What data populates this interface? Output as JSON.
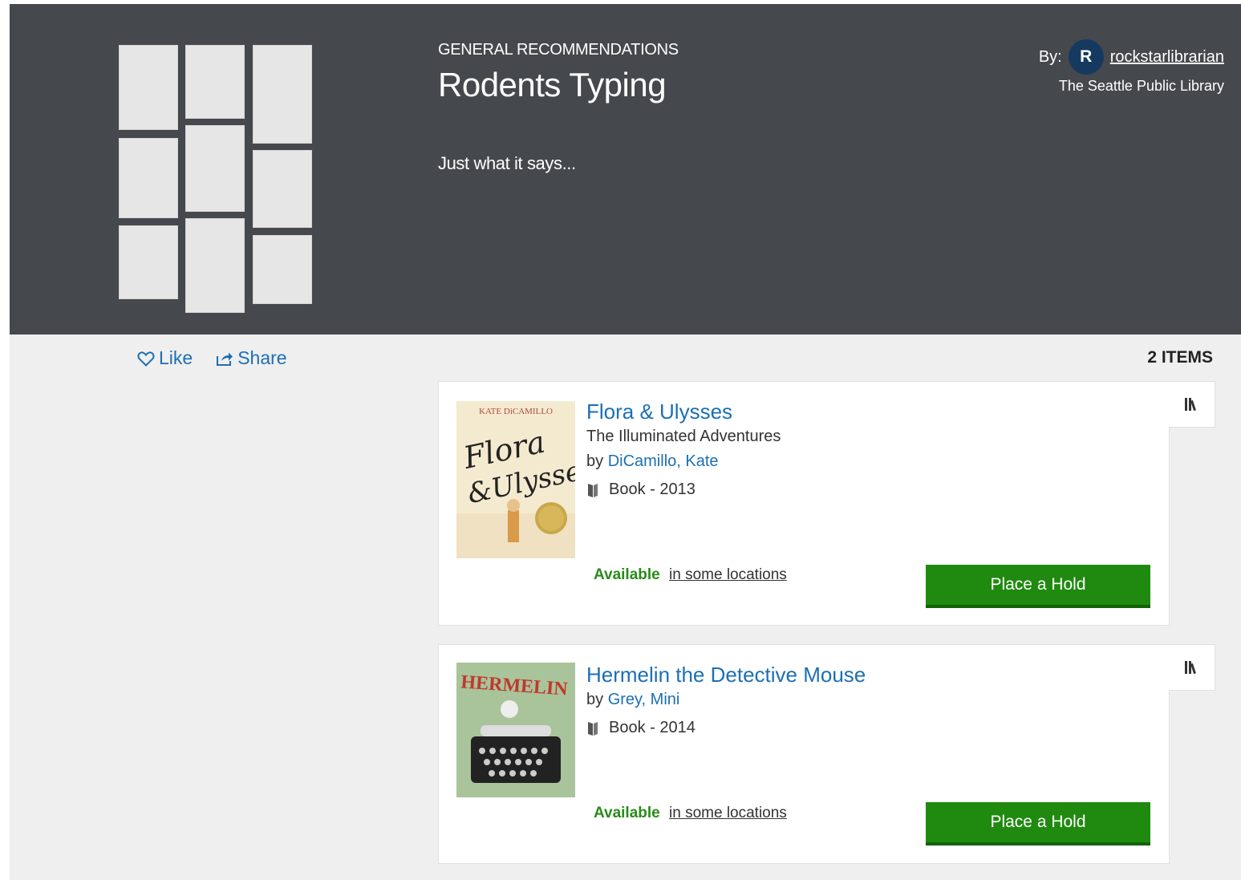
{
  "header": {
    "eyebrow": "GENERAL RECOMMENDATIONS",
    "title": "Rodents Typing",
    "description": "Just what it says...",
    "by_label": "By:",
    "avatar_initial": "R",
    "author": "rockstarlibrarian",
    "library": "The Seattle Public Library"
  },
  "actions": {
    "like": "Like",
    "share": "Share"
  },
  "item_count": "2 ITEMS",
  "items": [
    {
      "title": "Flora & Ulysses",
      "subtitle": "The Illuminated Adventures",
      "by": "by",
      "author": "DiCamillo, Kate",
      "format": "Book - 2013",
      "availability": "Available",
      "availability_link": "in some locations",
      "hold_label": "Place a Hold",
      "cover": {
        "top_text": "KATE DiCAMILLO",
        "script_text_1": "Flora",
        "script_text_2": "&Ulysses"
      }
    },
    {
      "title": "Hermelin the Detective Mouse",
      "by": "by",
      "author": "Grey, Mini",
      "format": "Book - 2014",
      "availability": "Available",
      "availability_link": "in some locations",
      "hold_label": "Place a Hold",
      "cover": {
        "top_text": "HERMELIN"
      }
    }
  ],
  "colors": {
    "header_bg": "#45484d",
    "link": "#1c6fb4",
    "available": "#2a8a1a",
    "hold_button": "#1f8a0f",
    "avatar": "#163a5f"
  },
  "icons": {
    "like": "heart-icon",
    "share": "share-icon",
    "shelf": "shelf-icon",
    "format": "book-icon"
  }
}
